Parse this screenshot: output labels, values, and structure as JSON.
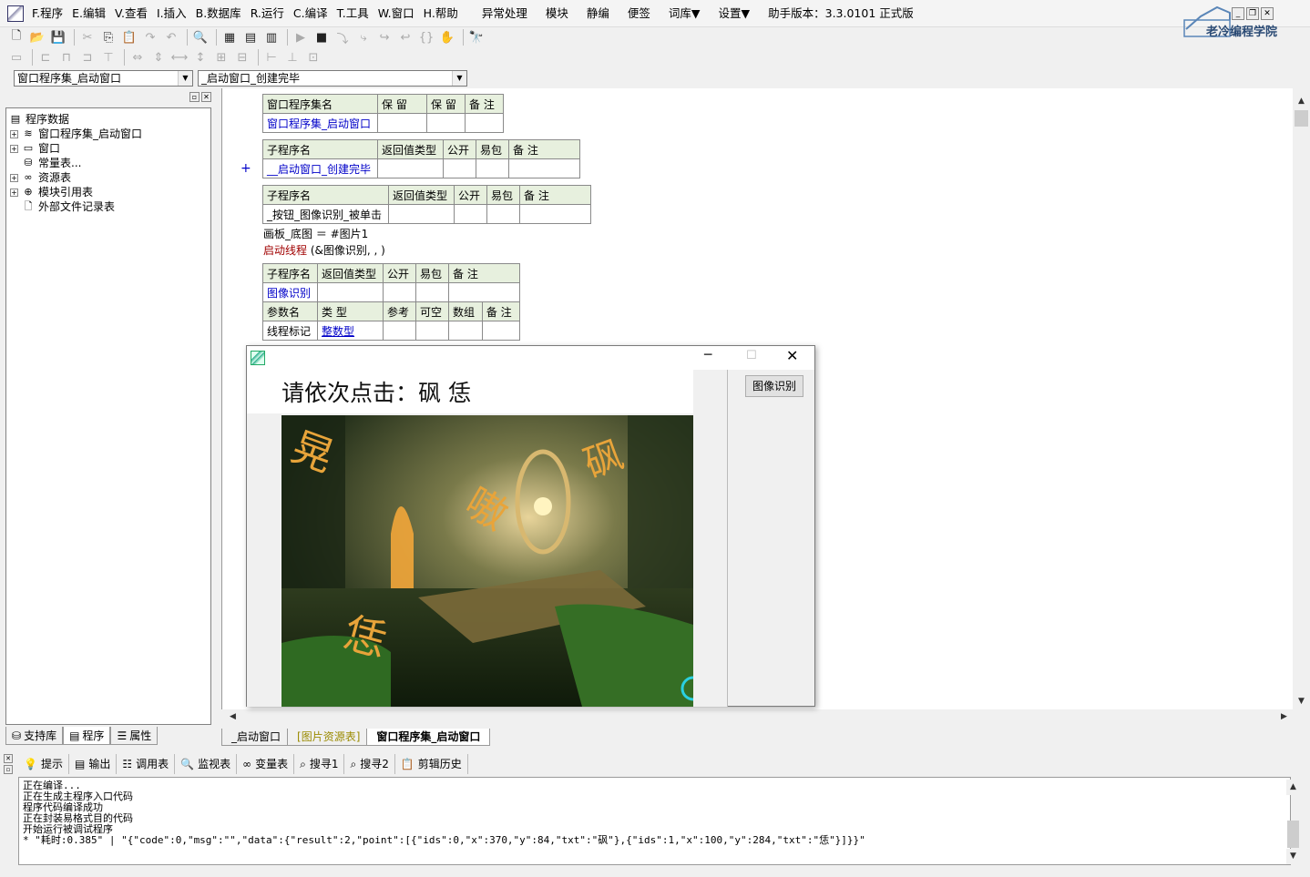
{
  "menu": {
    "items": [
      "F.程序",
      "E.编辑",
      "V.查看",
      "I.插入",
      "B.数据库",
      "R.运行",
      "C.编译",
      "T.工具",
      "W.窗口",
      "H.帮助"
    ],
    "extra": [
      "异常处理",
      "模块",
      "静编",
      "便签",
      "词库▼",
      "设置▼"
    ],
    "version": "助手版本：3.3.0101 正式版"
  },
  "logo_text": "老冷编程学院",
  "selectors": {
    "left": "窗口程序集_启动窗口",
    "right": "_启动窗口_创建完毕"
  },
  "tree": {
    "root": "程序数据",
    "items": [
      "窗口程序集_启动窗口",
      "窗口",
      "常量表...",
      "资源表",
      "模块引用表",
      "外部文件记录表"
    ]
  },
  "left_tabs": [
    "支持库",
    "程序",
    "属性"
  ],
  "code": {
    "t1": {
      "h": [
        "窗口程序集名",
        "保 留",
        "保 留",
        "备 注"
      ],
      "r": [
        "窗口程序集_启动窗口",
        "",
        "",
        ""
      ]
    },
    "t2": {
      "h": [
        "子程序名",
        "返回值类型",
        "公开",
        "易包",
        "备 注"
      ],
      "r": [
        "__启动窗口_创建完毕",
        "",
        "",
        "",
        ""
      ]
    },
    "t3": {
      "h": [
        "子程序名",
        "返回值类型",
        "公开",
        "易包",
        "备 注"
      ],
      "r": [
        "_按钮_图像识别_被单击",
        "",
        "",
        "",
        ""
      ]
    },
    "line1": "画板_底图 ＝ #图片1",
    "line2_kw": "启动线程",
    "line2_rest": " (&图像识别, , )",
    "t4": {
      "h": [
        "子程序名",
        "返回值类型",
        "公开",
        "易包",
        "备 注"
      ],
      "r": [
        "图像识别",
        "",
        "",
        "",
        ""
      ],
      "ph": [
        "参数名",
        "类 型",
        "参考",
        "可空",
        "数组",
        "备 注"
      ],
      "pr": [
        "线程标记",
        "整数型",
        "",
        "",
        "",
        ""
      ]
    },
    "plus": "+"
  },
  "doc_tabs": [
    "_启动窗口",
    "[图片资源表]",
    "窗口程序集_启动窗口"
  ],
  "bottom_tabs": [
    "提示",
    "输出",
    "调用表",
    "监视表",
    "变量表",
    "搜寻1",
    "搜寻2",
    "剪辑历史"
  ],
  "output_lines": [
    "正在编译...",
    "正在生成主程序入口代码",
    "程序代码编译成功",
    "正在封装易格式目的代码",
    "开始运行被调试程序",
    "* \"耗时:0.385\" | \"{\"code\":0,\"msg\":\"\",\"data\":{\"result\":2,\"point\":[{\"ids\":0,\"x\":370,\"y\":84,\"txt\":\"砜\"},{\"ids\":1,\"x\":100,\"y\":284,\"txt\":\"恁\"}]}}\""
  ],
  "dialog": {
    "prompt": "请依次点击：砜 恁",
    "button": "图像识别",
    "chars": [
      "晃",
      "砜",
      "嗷",
      "恁"
    ]
  }
}
